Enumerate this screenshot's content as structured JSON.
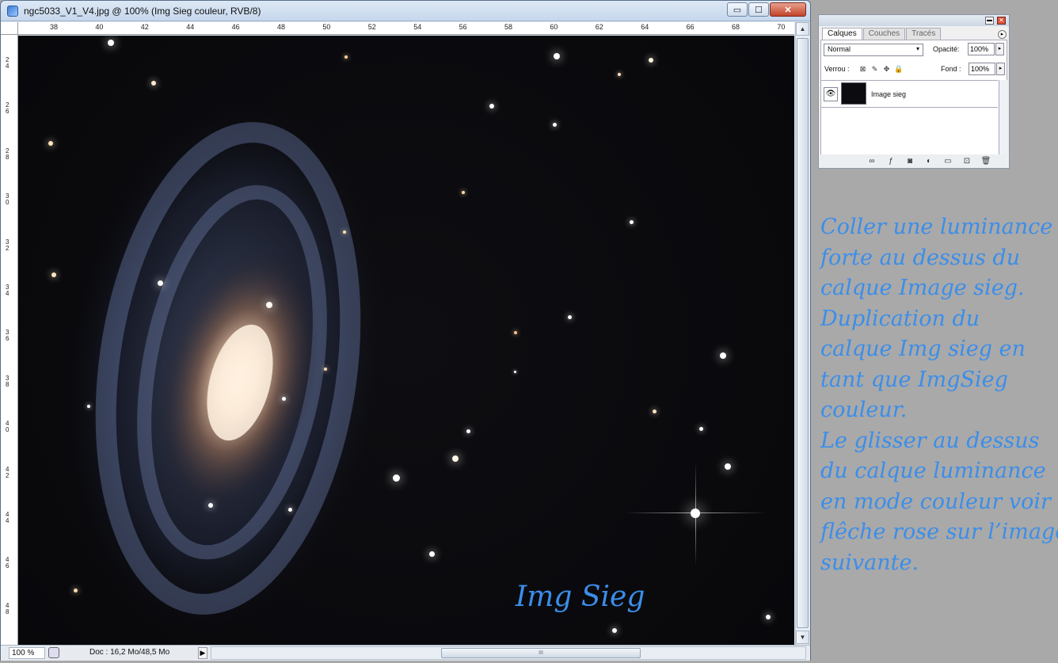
{
  "window": {
    "title": "ngc5033_V1_V4.jpg @ 100% (Img Sieg couleur, RVB/8)",
    "min_glyph": "▭",
    "max_glyph": "☐",
    "close_glyph": "✕"
  },
  "ruler": {
    "top_labels": [
      "38",
      "40",
      "42",
      "44",
      "46",
      "48",
      "50",
      "52",
      "54",
      "56",
      "58",
      "60",
      "62",
      "64",
      "66",
      "68",
      "70"
    ],
    "left_labels": [
      "24",
      "26",
      "28",
      "30",
      "32",
      "34",
      "36",
      "38",
      "40",
      "42",
      "44",
      "46",
      "48"
    ]
  },
  "canvas": {
    "overlay_label": "Img Sieg",
    "overlay_color": "#3b8eea"
  },
  "status": {
    "zoom": "100 %",
    "doc_info": "Doc : 16,2 Mo/48,5 Mo",
    "arrow_glyph": "▶",
    "thumb_grip": "III"
  },
  "layers_panel": {
    "tabs": [
      "Calques",
      "Couches",
      "Tracés"
    ],
    "active_tab": "Calques",
    "blend_mode": "Normal",
    "opacity_label": "Opacité:",
    "opacity_value": "100%",
    "lock_label": "Verrou :",
    "fill_label": "Fond :",
    "fill_value": "100%",
    "layer_name": "Image sieg",
    "minimize_glyph": "▬",
    "close_glyph": "✕",
    "menu_glyph": "▸",
    "caret_glyph": "▾",
    "arrow_glyph": "▸",
    "eye_glyph": "👁",
    "lock_glyphs": [
      "⊠",
      "✎",
      "✥",
      "🔒"
    ],
    "footer_icons": [
      "∞",
      "ƒ",
      "◙",
      "◐",
      "▭",
      "⊡",
      "🗑"
    ]
  },
  "note": {
    "lines": [
      "Coller une  luminance",
      "forte au dessus du",
      "calque Image sieg.",
      "Duplication du",
      "calque Img sieg en",
      "tant que ImgSieg",
      "couleur.",
      "Le glisser au dessus",
      "du calque luminance",
      "en mode couleur voir",
      "flêche rose sur l’image",
      "suivante."
    ],
    "color": "#3b8eea"
  }
}
